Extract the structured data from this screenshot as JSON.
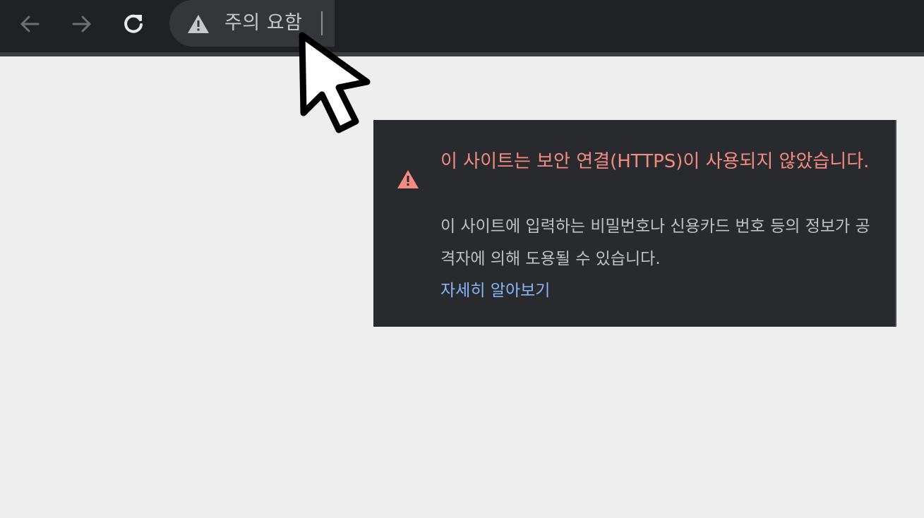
{
  "toolbar": {
    "back_icon": "arrow-left-icon",
    "forward_icon": "arrow-right-icon",
    "reload_icon": "reload-icon"
  },
  "omnibox": {
    "security_chip_icon": "warning-triangle-icon",
    "security_chip_label": "주의 요함"
  },
  "security_popup": {
    "icon": "warning-triangle-icon",
    "title": "이 사이트는 보안 연결(HTTPS)이 사용되지 않았습니다.",
    "description": "이 사이트에 입력하는 비밀번호나 신용카드 번호 등의 정보가 공격자에 의해 도용될 수 있습니다.",
    "learn_more_link": "자세히 알아보기"
  },
  "colors": {
    "toolbar_bg": "#202124",
    "popup_bg": "#292a2d",
    "warning_red": "#f28b82",
    "link_blue": "#8ab4f8",
    "page_bg": "#eeeeee"
  }
}
